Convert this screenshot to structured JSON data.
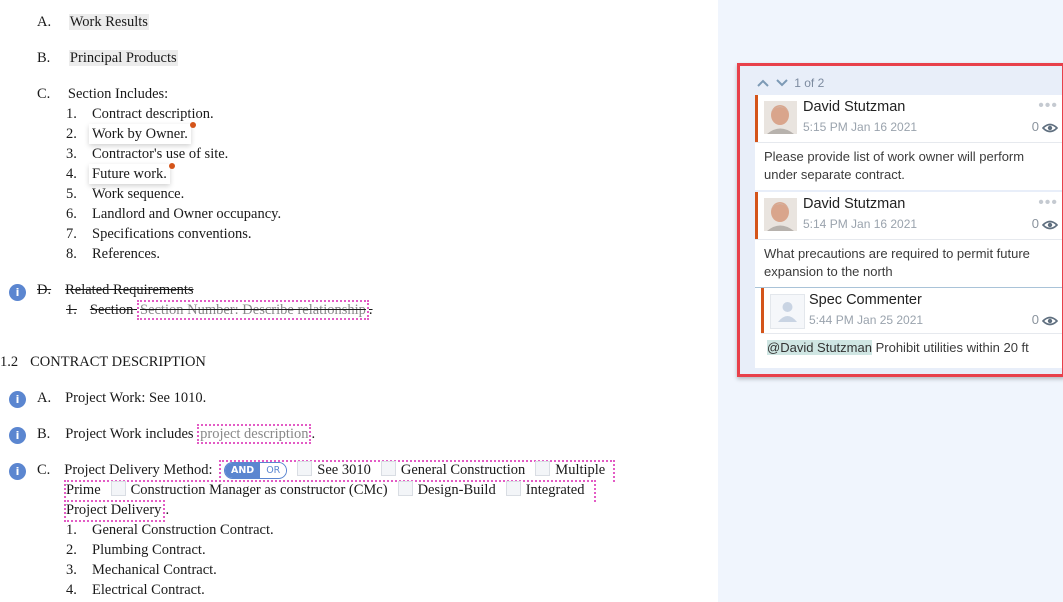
{
  "document": {
    "items_top": [
      {
        "letter": "A.",
        "text": "Work Results"
      },
      {
        "letter": "B.",
        "text": "Principal Products"
      },
      {
        "letter": "C.",
        "text": "Section Includes:"
      }
    ],
    "section_includes": [
      {
        "num": "1.",
        "text": "Contract description."
      },
      {
        "num": "2.",
        "text": "Work by Owner."
      },
      {
        "num": "3.",
        "text": "Contractor's use of site."
      },
      {
        "num": "4.",
        "text": "Future work."
      },
      {
        "num": "5.",
        "text": "Work sequence."
      },
      {
        "num": "6.",
        "text": "Landlord and Owner occupancy."
      },
      {
        "num": "7.",
        "text": "Specifications conventions."
      },
      {
        "num": "8.",
        "text": "References."
      }
    ],
    "related": {
      "letter": "D.",
      "text": "Related Requirements",
      "sub_num": "1.",
      "sub_text": "Section",
      "placeholder": "Section Number: Describe relationship",
      "tail": "."
    },
    "contract_heading": {
      "num": "1.2",
      "text": "CONTRACT DESCRIPTION"
    },
    "contract_items": {
      "a": {
        "letter": "A.",
        "text": "Project Work: See 1010."
      },
      "b": {
        "letter": "B.",
        "text": "Project Work includes",
        "placeholder": "project description",
        "tail": "."
      },
      "c": {
        "letter": "C.",
        "text": "Project Delivery Method:",
        "toggle_on": "AND",
        "toggle_off": "OR",
        "options": [
          "See 3010",
          "General Construction",
          "Multiple Prime",
          "Construction Manager as constructor (CMc)",
          "Design-Build",
          "Integrated Project Delivery"
        ],
        "tail": "."
      }
    },
    "contracts": [
      {
        "num": "1.",
        "text": "General Construction Contract."
      },
      {
        "num": "2.",
        "text": "Plumbing Contract."
      },
      {
        "num": "3.",
        "text": "Mechanical Contract."
      },
      {
        "num": "4.",
        "text": "Electrical Contract."
      }
    ],
    "info_icon_glyph": "i"
  },
  "comments": {
    "pager": "1 of 2",
    "threads": [
      {
        "author": "David Stutzman",
        "time": "5:15 PM Jan 16 2021",
        "views": "0",
        "text": "Please provide list of work owner will perform under separate contract."
      },
      {
        "author": "David Stutzman",
        "time": "5:14 PM Jan 16 2021",
        "views": "0",
        "text": "What precautions are required to permit future expansion to the north"
      },
      {
        "author": "Spec Commenter",
        "time": "5:44 PM Jan 25 2021",
        "views": "0",
        "mention": "@David Stutzman",
        "text": "Prohibit utilities within 20 ft"
      }
    ],
    "more_glyph": "•••",
    "up_glyph": "⌃",
    "down_glyph": "⌄"
  }
}
